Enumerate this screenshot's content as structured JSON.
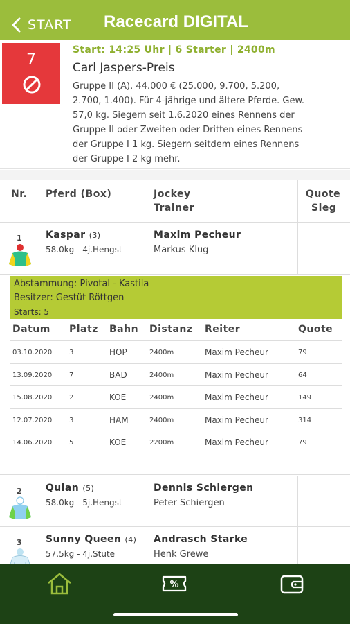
{
  "header": {
    "back_label": "START",
    "title": "Racecard DIGITAL"
  },
  "race": {
    "number": "7",
    "meta": "Start: 14:25 Uhr | 6 Starter | 2400m",
    "name": "Carl Jaspers-Preis",
    "description": "Gruppe II (A). 44.000 € (25.000, 9.700, 5.200, 2.700, 1.400). Für 4-jährige und ältere Pferde. Gew. 57,0 kg. Siegern seit 1.6.2020 eines Rennens der Gruppe II oder Zweiten oder Dritten eines Rennens der Gruppe I 1 kg. Siegern seitdem eines Rennens der Gruppe I 2 kg mehr."
  },
  "table_header": {
    "nr": "Nr.",
    "pferd": "Pferd (Box)",
    "jockey": "Jockey",
    "trainer": "Trainer",
    "quote": "Quote",
    "sieg": "Sieg"
  },
  "runners": [
    {
      "no": "1",
      "name": "Kaspar",
      "box": "(3)",
      "info": "58.0kg - 4j.Hengst",
      "jockey": "Maxim Pecheur",
      "trainer": "Markus Klug"
    },
    {
      "no": "2",
      "name": "Quian",
      "box": "(5)",
      "info": "58.0kg - 5j.Hengst",
      "jockey": "Dennis Schiergen",
      "trainer": "Peter Schiergen"
    },
    {
      "no": "3",
      "name": "Sunny Queen",
      "box": "(4)",
      "info": "57.5kg - 4j.Stute",
      "jockey": "Andrasch Starke",
      "trainer": "Henk Grewe"
    }
  ],
  "details": {
    "abstammung": "Abstammung: Pivotal - Kastila",
    "besitzer": "Besitzer: Gestüt Röttgen",
    "starts": "Starts: 5"
  },
  "form": {
    "headers": {
      "datum": "Datum",
      "platz": "Platz",
      "bahn": "Bahn",
      "distanz": "Distanz",
      "reiter": "Reiter",
      "quote": "Quote"
    },
    "rows": [
      {
        "datum": "03.10.2020",
        "platz": "3",
        "bahn": "HOP",
        "distanz": "2400m",
        "reiter": "Maxim Pecheur",
        "quote": "79"
      },
      {
        "datum": "13.09.2020",
        "platz": "7",
        "bahn": "BAD",
        "distanz": "2400m",
        "reiter": "Maxim Pecheur",
        "quote": "64"
      },
      {
        "datum": "15.08.2020",
        "platz": "2",
        "bahn": "KOE",
        "distanz": "2400m",
        "reiter": "Maxim Pecheur",
        "quote": "149"
      },
      {
        "datum": "12.07.2020",
        "platz": "3",
        "bahn": "HAM",
        "distanz": "2400m",
        "reiter": "Maxim Pecheur",
        "quote": "314"
      },
      {
        "datum": "14.06.2020",
        "platz": "5",
        "bahn": "KOE",
        "distanz": "2200m",
        "reiter": "Maxim Pecheur",
        "quote": "79"
      }
    ]
  },
  "nav": {
    "items": [
      "home-icon",
      "betting-ticket-icon",
      "wallet-icon"
    ]
  },
  "colors": {
    "brand_green": "#9bbd3c",
    "dark_green": "#1d4215",
    "race_red": "#e5383b",
    "highlight": "#b5cb35"
  }
}
